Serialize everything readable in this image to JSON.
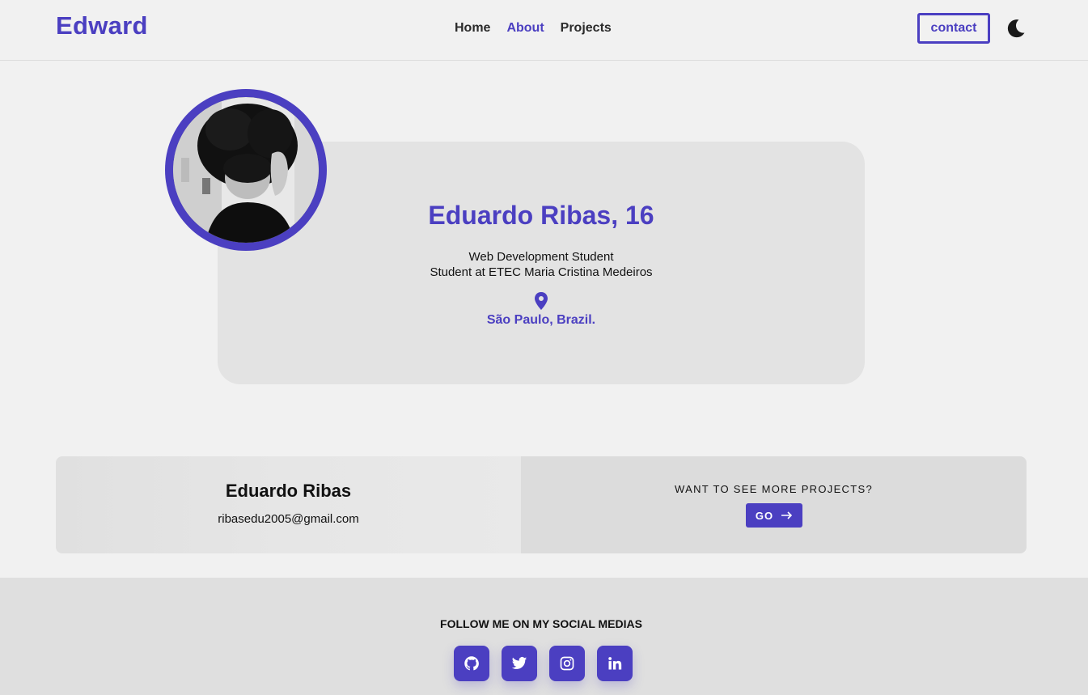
{
  "header": {
    "logo": "Edward",
    "nav": [
      {
        "label": "Home",
        "active": false
      },
      {
        "label": "About",
        "active": true
      },
      {
        "label": "Projects",
        "active": false
      }
    ],
    "contact_label": "contact",
    "theme_icon": "moon-icon"
  },
  "profile": {
    "name": "Eduardo Ribas, 16",
    "line1": "Web Development Student",
    "line2": "Student at ETEC Maria Cristina Medeiros",
    "location_icon": "map-pin-icon",
    "location": "São Paulo, Brazil."
  },
  "info": {
    "name": "Eduardo Ribas",
    "email": "ribasedu2005@gmail.com",
    "more_text": "WANT TO SEE MORE PROJECTS?",
    "go_label": "GO"
  },
  "footer": {
    "follow_text": "FOLLOW ME ON MY SOCIAL MEDIAS",
    "socials": [
      "github-icon",
      "twitter-icon",
      "instagram-icon",
      "linkedin-icon"
    ]
  },
  "colors": {
    "accent": "#4b3fc1",
    "background": "#f1f1f1",
    "card": "#e3e3e3",
    "footer": "#dfdfdf"
  }
}
